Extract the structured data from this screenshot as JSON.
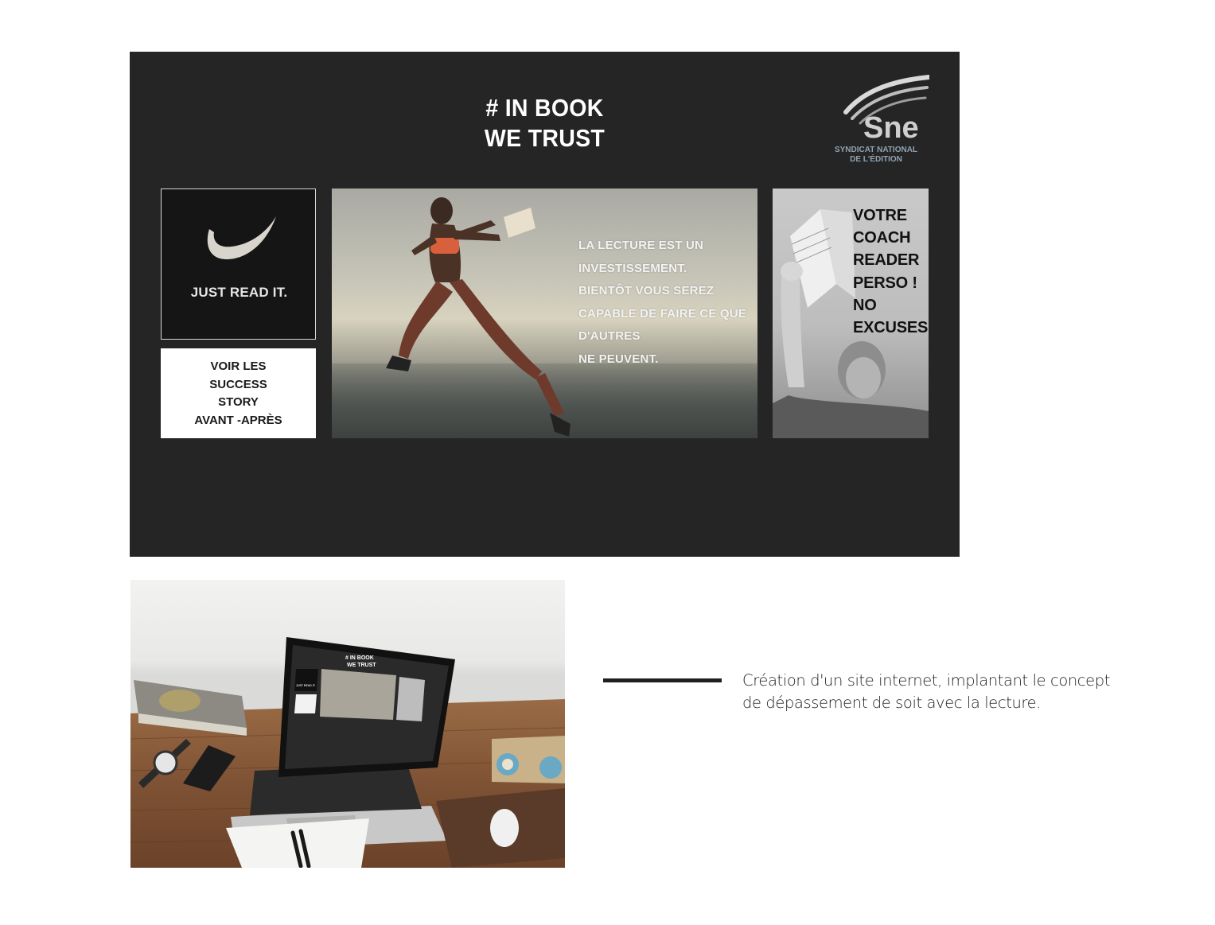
{
  "site": {
    "title_lines": [
      "# IN BOOK",
      "WE TRUST"
    ],
    "logo": {
      "mark": "Sne",
      "caption_lines": [
        "SYNDICAT NATIONAL",
        "DE L'ÉDITION"
      ],
      "caption_color": "#8fa3b3"
    },
    "nike_tile": {
      "icon": "swoosh-icon",
      "slogan": "JUST READ IT."
    },
    "success_button": {
      "lines": [
        "VOIR LES",
        "SUCCESS",
        "STORY",
        "AVANT -APRÈS"
      ]
    },
    "hero": {
      "text_lines": [
        "LA LECTURE EST UN",
        "INVESTISSEMENT.",
        "BIENTÔT VOUS SEREZ",
        "CAPABLE DE FAIRE CE QUE",
        "D'AUTRES",
        "NE PEUVENT."
      ]
    },
    "coach_tile": {
      "text_lines": [
        "VOTRE",
        "COACH",
        "READER",
        "PERSO !",
        "NO",
        "EXCUSES"
      ]
    },
    "background_color": "#252525"
  },
  "mockup_screen": {
    "title_lines": [
      "# IN BOOK",
      "WE TRUST"
    ],
    "slogan": "JUST READ IT."
  },
  "caption": {
    "lines": [
      "Création d'un site internet, implantant le concept",
      "de dépassement de soit avec la lecture."
    ]
  }
}
